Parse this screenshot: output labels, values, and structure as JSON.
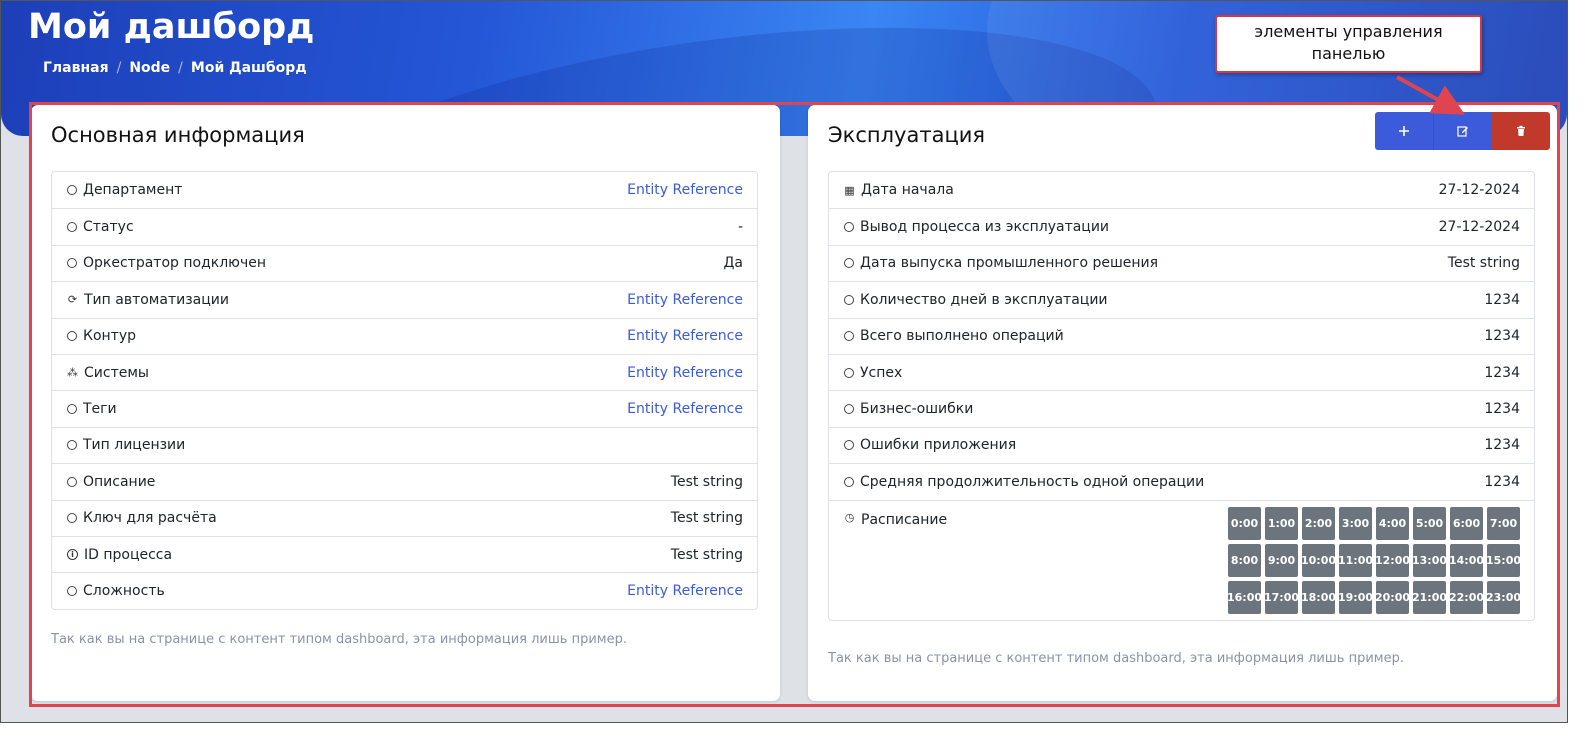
{
  "header": {
    "title": "Мой дашборд",
    "breadcrumb": [
      "Главная",
      "Node",
      "Мой Дашборд"
    ]
  },
  "main_info": {
    "title": "Основная информация",
    "rows": [
      {
        "icon": "circle-icon",
        "label": "Департамент",
        "value": "Entity Reference",
        "link": true
      },
      {
        "icon": "circle-icon",
        "label": "Статус",
        "value": "-",
        "link": false
      },
      {
        "icon": "circle-icon",
        "label": "Оркестратор подключен",
        "value": "Да",
        "link": false
      },
      {
        "icon": "sync-icon",
        "label": "Тип автоматизации",
        "value": "Entity Reference",
        "link": true
      },
      {
        "icon": "circle-icon",
        "label": "Контур",
        "value": "Entity Reference",
        "link": true
      },
      {
        "icon": "diagram-icon",
        "label": "Системы",
        "value": "Entity Reference",
        "link": true
      },
      {
        "icon": "circle-icon",
        "label": "Теги",
        "value": "Entity Reference",
        "link": true
      },
      {
        "icon": "circle-icon",
        "label": "Тип лицензии",
        "value": "",
        "link": false
      },
      {
        "icon": "circle-icon",
        "label": "Описание",
        "value": "Test string",
        "link": false
      },
      {
        "icon": "circle-icon",
        "label": "Ключ для расчёта",
        "value": "Test string",
        "link": false
      },
      {
        "icon": "info-icon",
        "label": "ID процесса",
        "value": "Test string",
        "link": false
      },
      {
        "icon": "circle-icon",
        "label": "Сложность",
        "value": "Entity Reference",
        "link": true
      }
    ],
    "note": "Так как вы на странице с контент типом dashboard, эта информация лишь пример."
  },
  "operation": {
    "title": "Эксплуатация",
    "rows": [
      {
        "icon": "calendar-icon",
        "label": "Дата начала",
        "value": "27-12-2024"
      },
      {
        "icon": "circle-icon",
        "label": "Вывод процесса из эксплуатации",
        "value": "27-12-2024"
      },
      {
        "icon": "circle-icon",
        "label": "Дата выпуска промышленного решения",
        "value": "Test string"
      },
      {
        "icon": "circle-icon",
        "label": "Количество дней в эксплуатации",
        "value": "1234"
      },
      {
        "icon": "circle-icon",
        "label": "Всего выполнено операций",
        "value": "1234"
      },
      {
        "icon": "circle-icon",
        "label": "Успех",
        "value": "1234"
      },
      {
        "icon": "circle-icon",
        "label": "Бизнес-ошибки",
        "value": "1234"
      },
      {
        "icon": "circle-icon",
        "label": "Ошибки приложения",
        "value": "1234"
      },
      {
        "icon": "circle-icon",
        "label": "Средняя продолжительность одной операции",
        "value": "1234"
      }
    ],
    "schedule": {
      "icon": "clock-icon",
      "label": "Расписание",
      "hours": [
        "0:00",
        "1:00",
        "2:00",
        "3:00",
        "4:00",
        "5:00",
        "6:00",
        "7:00",
        "8:00",
        "9:00",
        "10:00",
        "11:00",
        "12:00",
        "13:00",
        "14:00",
        "15:00",
        "16:00",
        "17:00",
        "18:00",
        "19:00",
        "20:00",
        "21:00",
        "22:00",
        "23:00"
      ]
    },
    "note": "Так как вы на странице с контент типом dashboard, эта информация лишь пример."
  },
  "toolbar": {
    "add_icon": "plus-icon",
    "edit_icon": "edit-icon",
    "delete_icon": "trash-icon",
    "colors": {
      "primary": "#3b5bdb",
      "danger": "#c0392b"
    }
  },
  "annotation": {
    "callout_line1": "элементы управления",
    "callout_line2": "панелью",
    "color": "#e0444e"
  }
}
